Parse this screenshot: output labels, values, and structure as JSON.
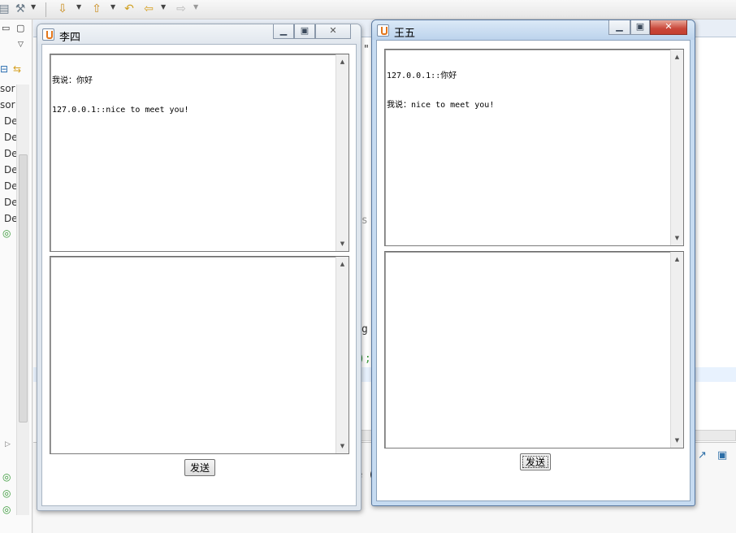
{
  "ide": {
    "left_items": [
      "sor",
      "sor",
      "De",
      "De",
      "De",
      "De",
      "De",
      "De",
      "De"
    ],
    "code_fragments": [
      "\"",
      "\"s",
      "g",
      "e ("
    ]
  },
  "windows": [
    {
      "title": "李四",
      "state": "inactive",
      "received_lines": [
        "我说：你好",
        "127.0.0.1::nice to meet you!"
      ],
      "input_value": "",
      "send_label": "发送"
    },
    {
      "title": "王五",
      "state": "active",
      "received_lines": [
        "127.0.0.1::你好",
        "我说：nice to meet you!"
      ],
      "input_value": "",
      "send_label": "发送"
    }
  ],
  "icons": {
    "minimize": "minimize-icon",
    "maximize": "maximize-icon",
    "close": "close-icon",
    "java": "java-icon"
  }
}
